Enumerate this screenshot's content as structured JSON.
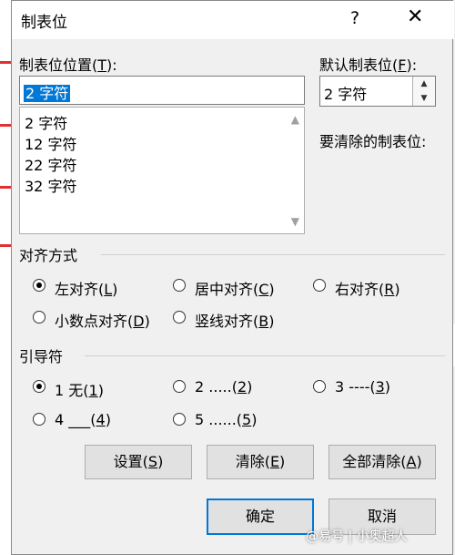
{
  "dialog": {
    "title": "制表位",
    "help_icon": "?",
    "close_icon": "✕"
  },
  "tab_position": {
    "label": "制表位位置",
    "hotkey_open": "(",
    "hotkey": "T",
    "hotkey_close": "):",
    "value": "2 字符",
    "list": [
      "2 字符",
      "12 字符",
      "22 字符",
      "32 字符"
    ]
  },
  "default_tab": {
    "label": "默认制表位",
    "hotkey_open": "(",
    "hotkey": "F",
    "hotkey_close": "):",
    "value": "2 字符"
  },
  "clear_label": "要清除的制表位:",
  "alignment": {
    "label": "对齐方式",
    "options": [
      {
        "text": "左对齐(",
        "key": "L",
        "close": ")",
        "checked": true
      },
      {
        "text": "居中对齐(",
        "key": "C",
        "close": ")",
        "checked": false
      },
      {
        "text": "右对齐(",
        "key": "R",
        "close": ")",
        "checked": false
      },
      {
        "text": "小数点对齐(",
        "key": "D",
        "close": ")",
        "checked": false
      },
      {
        "text": "竖线对齐(",
        "key": "B",
        "close": ")",
        "checked": false
      }
    ]
  },
  "leader": {
    "label": "引导符",
    "options": [
      {
        "text": "1 无(",
        "key": "1",
        "close": ")",
        "checked": true
      },
      {
        "text": "2 .....(",
        "key": "2",
        "close": ")",
        "checked": false
      },
      {
        "text": "3 ----(",
        "key": "3",
        "close": ")",
        "checked": false
      },
      {
        "text": "4 ___(",
        "key": "4",
        "close": ")",
        "checked": false
      },
      {
        "text": "5 ......(",
        "key": "5",
        "close": ")",
        "checked": false
      }
    ]
  },
  "buttons": {
    "set": {
      "text": "设置(",
      "key": "S",
      "close": ")"
    },
    "clear": {
      "text": "清除(",
      "key": "E",
      "close": ")"
    },
    "clear_all": {
      "text": "全部清除(",
      "key": "A",
      "close": ")"
    },
    "ok": "确定",
    "cancel": "取消"
  },
  "watermark": "@易号 | 小奥超人"
}
